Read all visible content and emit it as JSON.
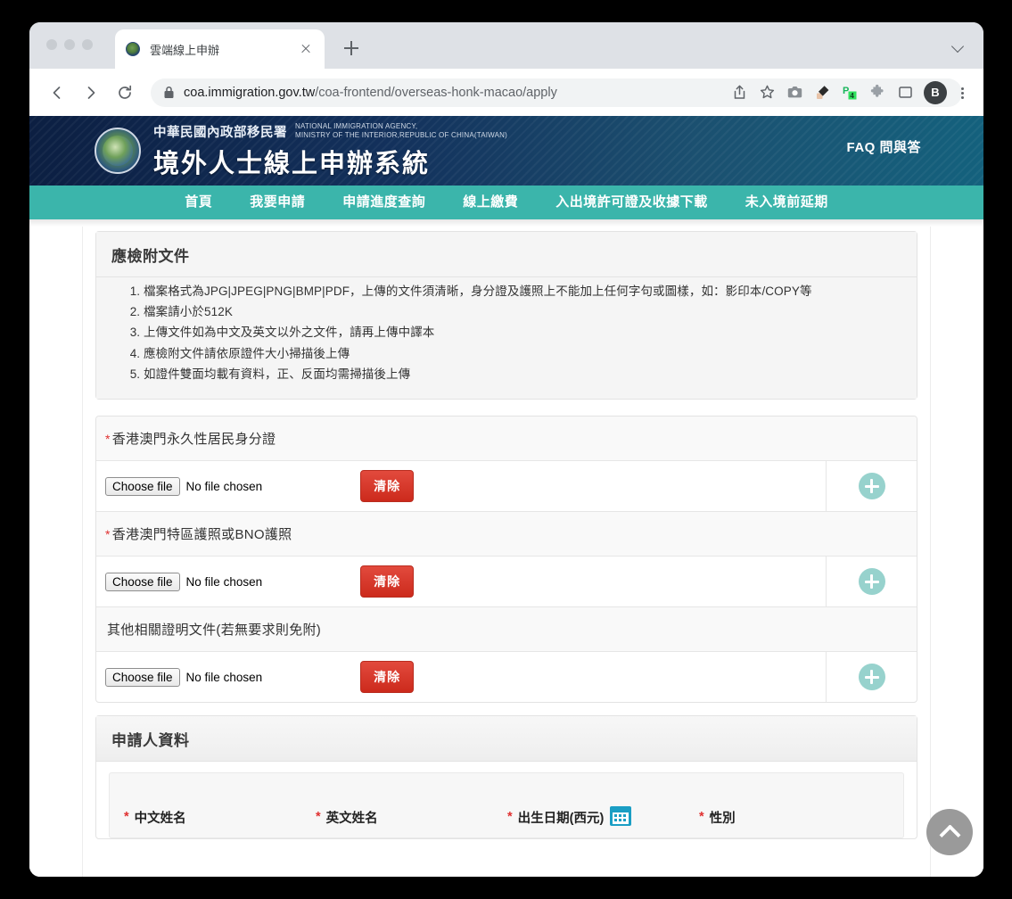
{
  "browser": {
    "tab": {
      "title": "雲端線上申辦",
      "favicon": "nia-emblem-icon",
      "close": "×"
    },
    "new_tab_label": "+",
    "url_secure": "coa.immigration.gov.tw",
    "url_path": "/coa-frontend/overseas-honk-macao/apply",
    "url_full": "coa.immigration.gov.tw/coa-frontend/overseas-honk-macao/apply",
    "profile_initial": "B",
    "toolbar_icons": [
      "back-icon",
      "forward-icon",
      "reload-icon",
      "lock-icon",
      "share-icon",
      "bookmark-star-icon",
      "screenshot-camera-icon",
      "eyedropper-icon",
      "p-extension-icon",
      "puzzle-extension-icon",
      "sidebar-icon",
      "profile-avatar",
      "kebab-menu-icon"
    ]
  },
  "site_header": {
    "agency_cn": "中華民國內政部移民署",
    "agency_en_line1": "NATIONAL IMMIGRATION AGENCY,",
    "agency_en_line2": "MINISTRY OF THE INTERIOR,REPUBLIC OF CHINA(TAIWAN)",
    "system_title": "境外人士線上申辦系統",
    "faq_label": "FAQ 問與答"
  },
  "nav": {
    "items": [
      {
        "label": "首頁"
      },
      {
        "label": "我要申請"
      },
      {
        "label": "申請進度查詢"
      },
      {
        "label": "線上繳費"
      },
      {
        "label": "入出境許可證及收據下載"
      },
      {
        "label": "未入境前延期"
      }
    ]
  },
  "documents_panel": {
    "title": "應檢附文件",
    "notes": [
      "檔案格式為JPG|JPEG|PNG|BMP|PDF，上傳的文件須清晰，身分證及護照上不能加上任何字句或圖樣，如：影印本/COPY等",
      "檔案請小於512K",
      "上傳文件如為中文及英文以外之文件，請再上傳中譯本",
      "應檢附文件請依原證件大小掃描後上傳",
      "如證件雙面均載有資料，正、反面均需掃描後上傳"
    ]
  },
  "uploads": {
    "choose_file_label": "Choose file",
    "no_file_label": "No file chosen",
    "clear_label": "清除",
    "add_label": "+",
    "rows": [
      {
        "label": "香港澳門永久性居民身分證",
        "required": true,
        "required_mark": "*"
      },
      {
        "label": "香港澳門特區護照或BNO護照",
        "required": true,
        "required_mark": "*"
      },
      {
        "label": "其他相關證明文件(若無要求則免附)",
        "required": false,
        "required_mark": ""
      }
    ]
  },
  "applicant_panel": {
    "title": "申請人資料",
    "fields": [
      {
        "label": "中文姓名",
        "required_mark": "*"
      },
      {
        "label": "英文姓名",
        "required_mark": "*"
      },
      {
        "label": "出生日期(西元)",
        "required_mark": "*",
        "icon": "calendar-icon"
      },
      {
        "label": "性別",
        "required_mark": "*"
      }
    ]
  },
  "scroll_top": {
    "name": "scroll-to-top",
    "glyph": "^"
  },
  "colors": {
    "header_navy": "#0c1f42",
    "nav_teal": "#3bb5ab",
    "clear_red": "#cc2a1c",
    "add_teal": "#97d2cd",
    "required_red": "#e03030"
  }
}
